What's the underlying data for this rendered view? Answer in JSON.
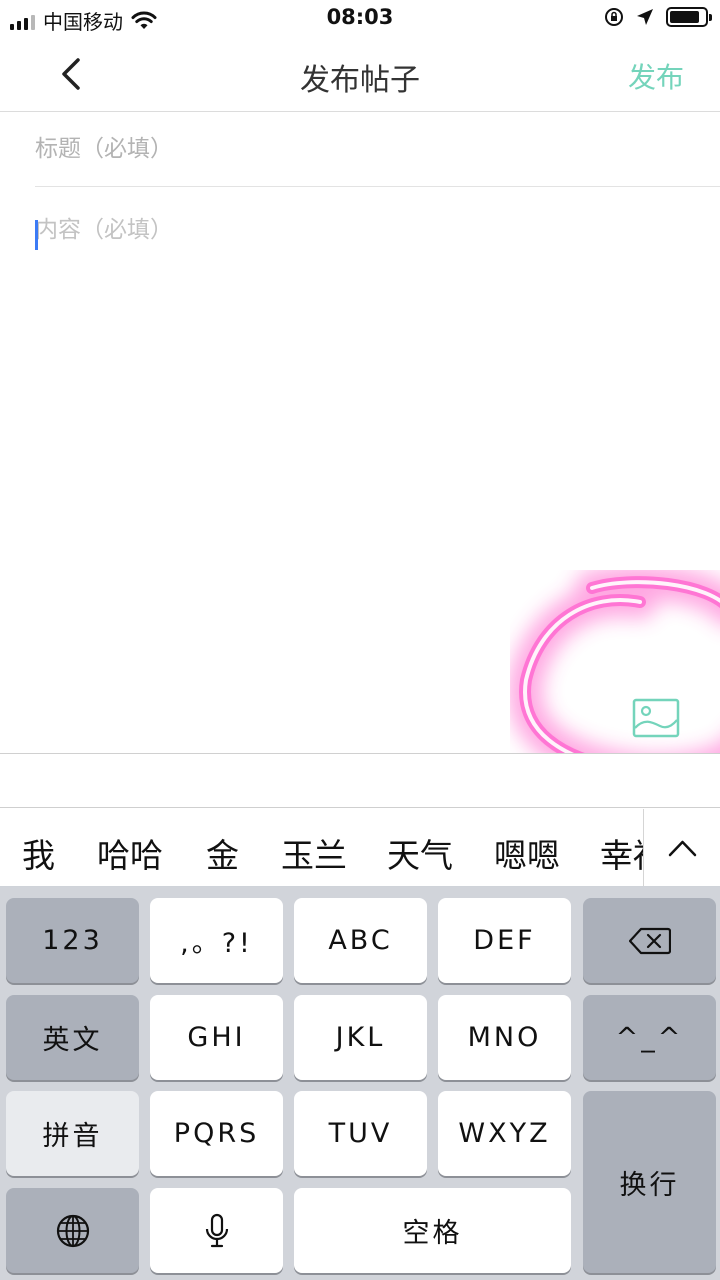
{
  "status_bar": {
    "carrier": "中国移动",
    "time": "08:03"
  },
  "nav": {
    "title": "发布帖子",
    "publish_label": "发布"
  },
  "form": {
    "title_placeholder": "标题（必填）",
    "content_placeholder": "内容（必填）"
  },
  "colors": {
    "accent": "#74d4bb",
    "caret": "#3c7bf5",
    "highlight": "#ff3fbf"
  },
  "candidates": [
    "我",
    "哈哈",
    "金",
    "玉兰",
    "天气",
    "嗯嗯",
    "幸福"
  ],
  "keyboard": {
    "row1": [
      "123",
      ",。?!",
      "ABC",
      "DEF"
    ],
    "row2": [
      "英文",
      "GHI",
      "JKL",
      "MNO",
      "^_^"
    ],
    "row3": [
      "拼音",
      "PQRS",
      "TUV",
      "WXYZ"
    ],
    "return_label": "换行",
    "space_label": "空格",
    "icons": [
      "delete-icon",
      "globe-icon",
      "microphone-icon"
    ]
  }
}
